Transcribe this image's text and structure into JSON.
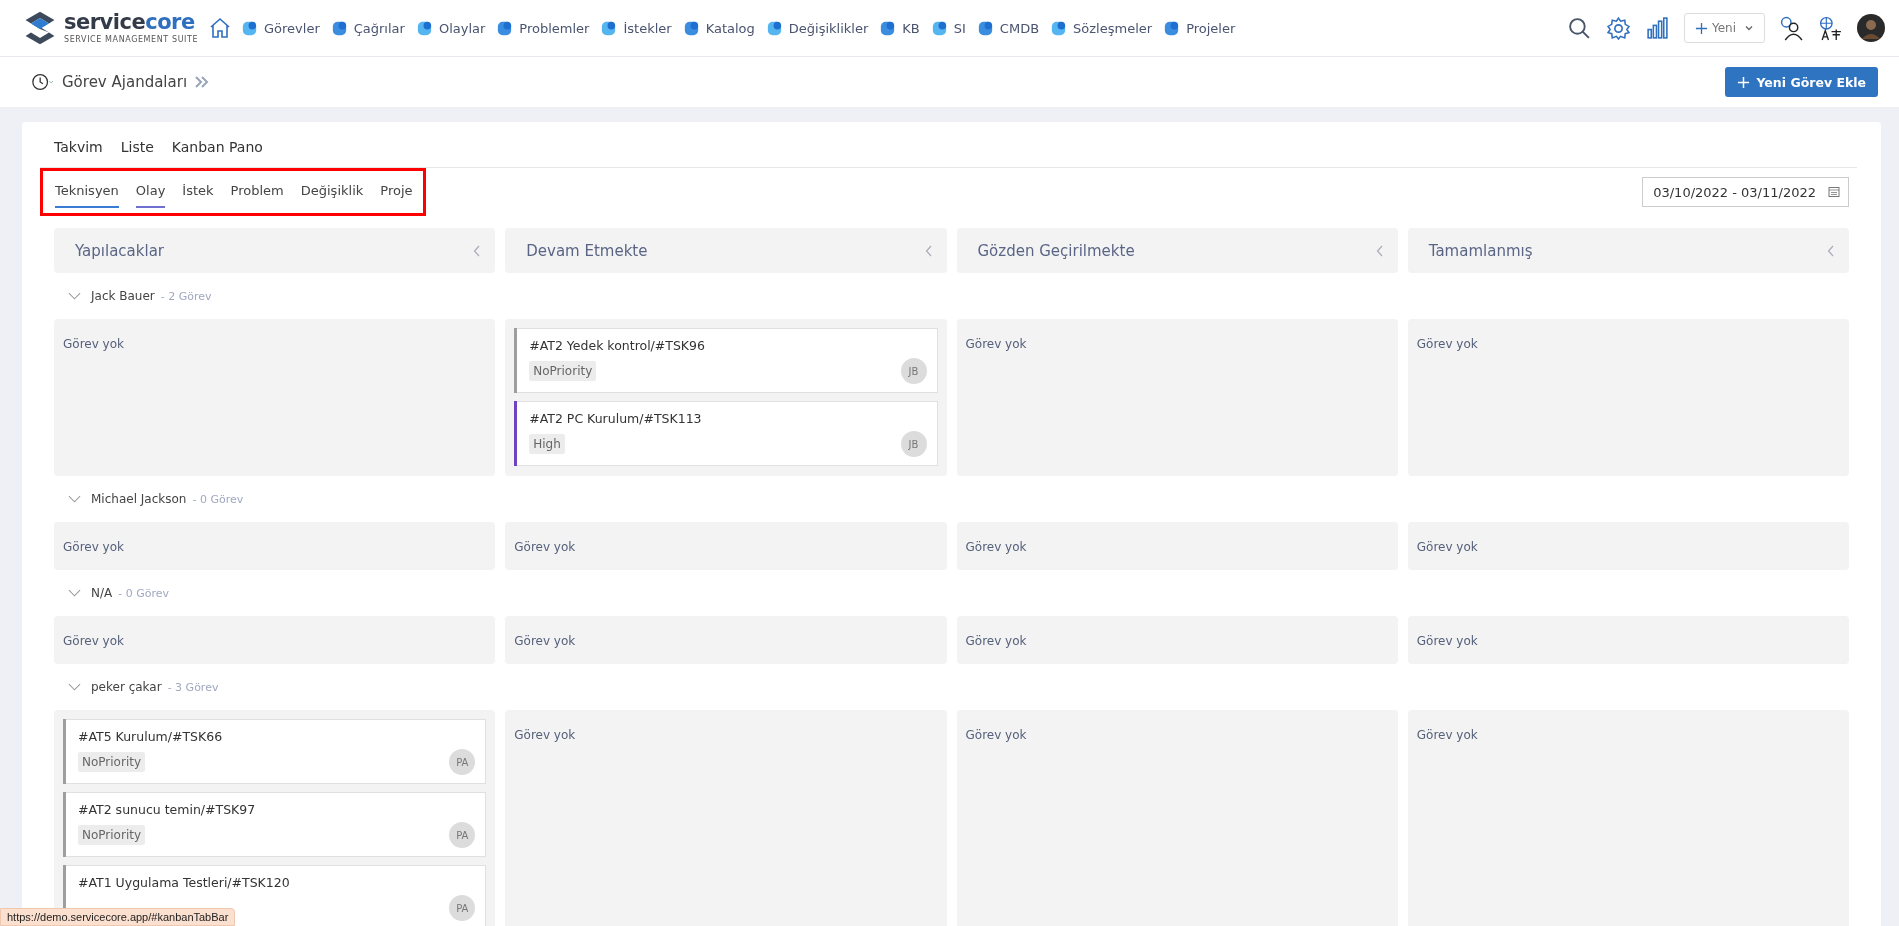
{
  "logo": {
    "name_main": "service",
    "name_accent": "core",
    "tagline": "SERVICE MANAGEMENT SUITE"
  },
  "nav": [
    "Görevler",
    "Çağrılar",
    "Olaylar",
    "Problemler",
    "İstekler",
    "Katalog",
    "Değişiklikler",
    "KB",
    "SI",
    "CMDB",
    "Sözleşmeler",
    "Projeler"
  ],
  "new_button": "Yeni",
  "breadcrumb": "Görev Ajandaları",
  "add_button": "Yeni Görev Ekle",
  "view_tabs": [
    "Takvim",
    "Liste",
    "Kanban Pano"
  ],
  "sub_tabs": [
    {
      "label": "Teknisyen",
      "selected": true,
      "hovered": false
    },
    {
      "label": "Olay",
      "selected": false,
      "hovered": true
    },
    {
      "label": "İstek",
      "selected": false,
      "hovered": false
    },
    {
      "label": "Problem",
      "selected": false,
      "hovered": false
    },
    {
      "label": "Değişiklik",
      "selected": false,
      "hovered": false
    },
    {
      "label": "Proje",
      "selected": false,
      "hovered": false
    }
  ],
  "sub_tabs_highlighted": true,
  "date_range": "03/10/2022 - 03/11/2022",
  "columns": [
    "Yapılacaklar",
    "Devam Etmekte",
    "Gözden Geçirilmekte",
    "Tamamlanmış"
  ],
  "groups": [
    {
      "name": "Jack Bauer",
      "count": "- 2 Görev",
      "cells": [
        {
          "empty": "Görev yok"
        },
        {
          "cards": [
            {
              "title": "#AT2 Yedek kontrol/#TSK96",
              "priority": "NoPriority",
              "avatar": "JB",
              "color": "#9e9e9e"
            },
            {
              "title": "#AT2 PC Kurulum/#TSK113",
              "priority": "High",
              "avatar": "JB",
              "color": "#6f42c1"
            }
          ]
        },
        {
          "empty": "Görev yok"
        },
        {
          "empty": "Görev yok"
        }
      ]
    },
    {
      "name": "Michael Jackson",
      "count": "- 0 Görev",
      "cells": [
        {
          "empty": "Görev yok"
        },
        {
          "empty": "Görev yok"
        },
        {
          "empty": "Görev yok"
        },
        {
          "empty": "Görev yok"
        }
      ]
    },
    {
      "name": "N/A",
      "count": "- 0 Görev",
      "cells": [
        {
          "empty": "Görev yok"
        },
        {
          "empty": "Görev yok"
        },
        {
          "empty": "Görev yok"
        },
        {
          "empty": "Görev yok"
        }
      ]
    },
    {
      "name": "peker çakar",
      "count": "- 3 Görev",
      "cells": [
        {
          "cards": [
            {
              "title": "#AT5 Kurulum/#TSK66",
              "priority": "NoPriority",
              "avatar": "PA",
              "color": "#9e9e9e"
            },
            {
              "title": "#AT2 sunucu temin/#TSK97",
              "priority": "NoPriority",
              "avatar": "PA",
              "color": "#9e9e9e"
            },
            {
              "title": "#AT1 Uygulama Testleri/#TSK120",
              "avatar": "PA",
              "color": "#9e9e9e"
            }
          ]
        },
        {
          "empty": "Görev yok"
        },
        {
          "empty": "Görev yok"
        },
        {
          "empty": "Görev yok"
        }
      ]
    }
  ],
  "status_url": "https://demo.servicecore.app/#kanbanTabBar"
}
